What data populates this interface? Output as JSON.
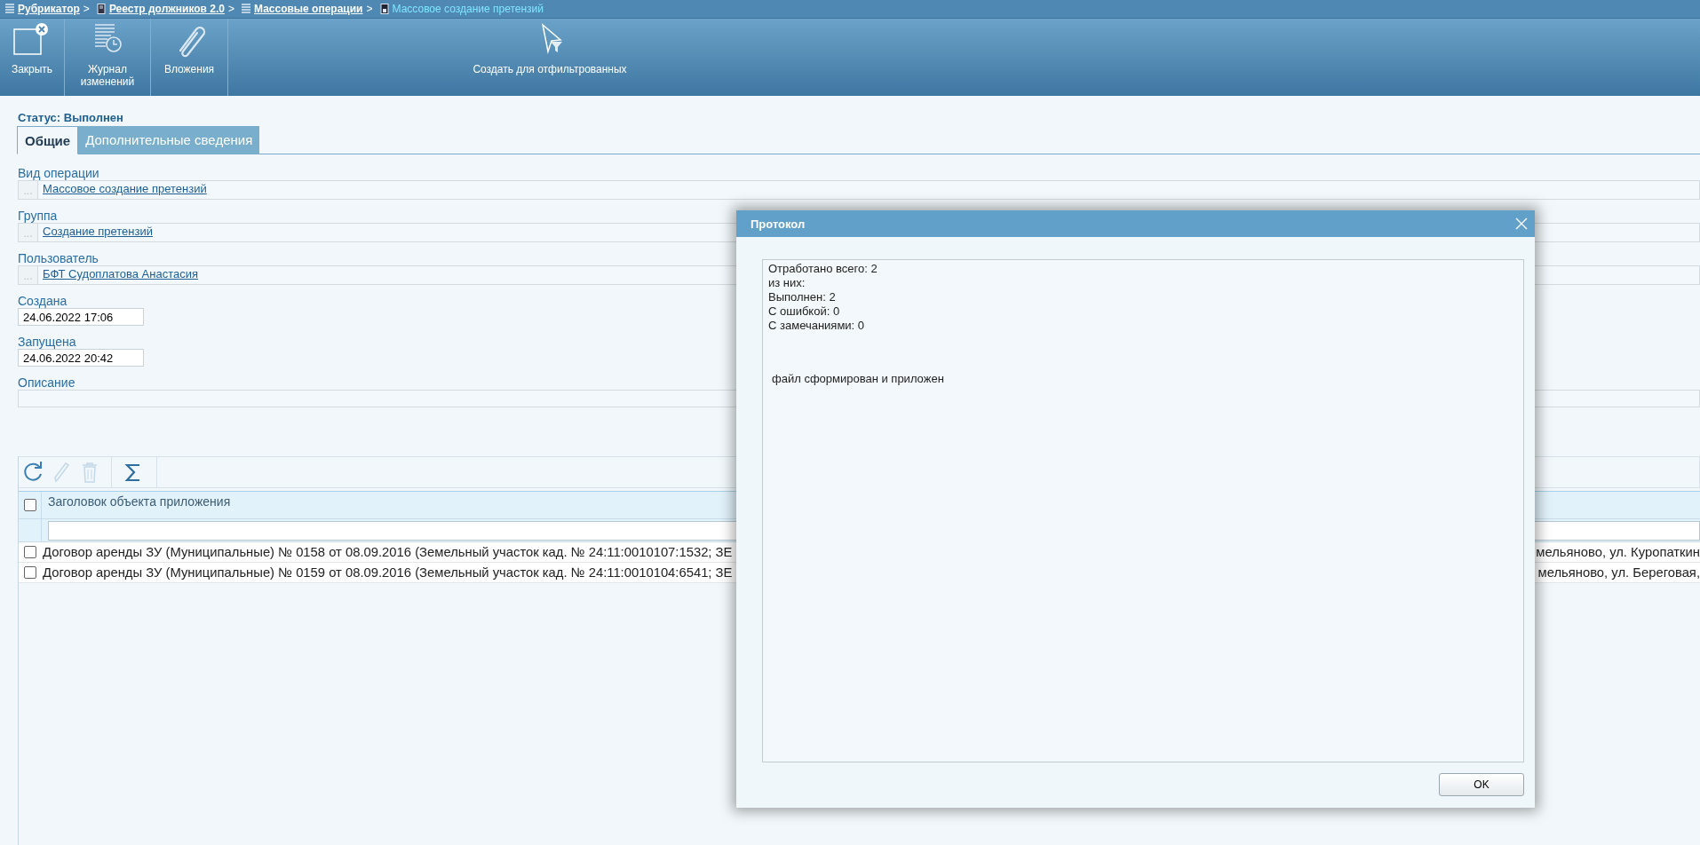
{
  "breadcrumbs": [
    {
      "label": "Рубрикатор",
      "separator": ">",
      "current": false
    },
    {
      "label": "Реестр должников 2.0",
      "separator": ">",
      "current": false
    },
    {
      "label": "Массовые операции",
      "separator": ">",
      "current": false
    },
    {
      "label": "Массовое создание претензий",
      "current": true
    }
  ],
  "toolbar": [
    {
      "label": "Закрыть"
    },
    {
      "label": "Журнал\nизменений"
    },
    {
      "label": "Вложения"
    },
    {
      "label": "Создать для отфильтрованных"
    }
  ],
  "status": "Статус: Выполнен",
  "tabs": [
    {
      "label": "Общие",
      "selected": true
    },
    {
      "label": "Дополнительные сведения",
      "selected": false
    }
  ],
  "fields": [
    {
      "kind": "link",
      "label": "Вид операции",
      "browse": "...",
      "value": "Массовое создание претензий"
    },
    {
      "kind": "link",
      "label": "Группа",
      "browse": "...",
      "value": "Создание претензий"
    },
    {
      "kind": "link",
      "label": "Пользователь",
      "browse": "...",
      "value": "БФТ Судоплатова Анастасия"
    },
    {
      "kind": "date",
      "label": "Создана",
      "value": "24.06.2022 17:06"
    },
    {
      "kind": "date",
      "label": "Запущена",
      "value": "24.06.2022 20:42"
    },
    {
      "kind": "text",
      "label": "Описание"
    }
  ],
  "grid_toolbar": [
    {
      "disabled": false
    },
    {
      "disabled": true
    },
    {
      "disabled": true
    },
    {
      "disabled": false
    }
  ],
  "table": {
    "header_checked": false,
    "columns": [
      "Заголовок объекта приложения"
    ],
    "rows": [
      {
        "checked": false,
        "text_left": "Договор аренды ЗУ (Муниципальные) № 0158 от 08.09.2016 (Земельный участок кад. № 24:11:0010107:1532; ЗЕ",
        "text_right": "мельяново, ул. Куропаткин"
      },
      {
        "checked": false,
        "text_left": "Договор аренды ЗУ (Муниципальные) № 0159 от 08.09.2016 (Земельный участок кад. № 24:11:0010104:6541; ЗЕ",
        "text_right": "мельяново, ул. Береговая,"
      }
    ]
  },
  "dialog": {
    "title": "Протокол",
    "lines": [
      "Отработано всего: 2",
      "из них:",
      "Выполнен: 2",
      "С ошибкой: 0",
      "С замечаниями: 0"
    ],
    "note": "файл сформирован и приложен",
    "ok": "OK"
  }
}
